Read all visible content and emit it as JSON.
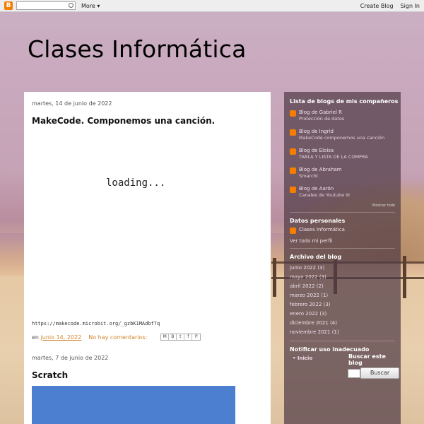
{
  "navbar": {
    "logo_text": "B",
    "more_label": "More ▾",
    "create_blog": "Create Blog",
    "sign_in": "Sign In"
  },
  "blog_title": "Clases Informática",
  "posts": [
    {
      "date": "martes, 14 de junio de 2022",
      "title": "MakeCode. Componemos una canción.",
      "embed_text": "loading...",
      "link": "https://makecode.microbit.org/_gzbK1MAdbf7q",
      "footer_prefix": "en",
      "footer_date": "junio 14, 2022",
      "comments": "No hay comentarios:",
      "share_buttons": [
        "M",
        "B",
        "t",
        "f",
        "P"
      ]
    },
    {
      "date": "martes, 7 de junio de 2022",
      "title": "Scratch"
    }
  ],
  "sidebar": {
    "blogs_heading": "Lista de blogs de mis compañeros",
    "blogs": [
      {
        "name": "Blog de Gabriel R",
        "sub": "Protección de datos"
      },
      {
        "name": "Blog de Ingrid",
        "sub": "MakeCode componemos una canción"
      },
      {
        "name": "Blog de Eloisa",
        "sub": "TABLA Y LISTA DE LA COMPRA"
      },
      {
        "name": "Blog de Abraham",
        "sub": "Smarcht"
      },
      {
        "name": "Blog de Aarón",
        "sub": "Canales de Youtube III"
      }
    ],
    "show_all": "Mostrar todo",
    "profile_heading": "Datos personales",
    "profile_name": "Clases Informática",
    "profile_link": "Ver todo mi perfil",
    "archive_heading": "Archivo del blog",
    "archive": [
      {
        "month": "junio 2022",
        "count": "(3)"
      },
      {
        "month": "mayo 2022",
        "count": "(3)"
      },
      {
        "month": "abril 2022",
        "count": "(2)"
      },
      {
        "month": "marzo 2022",
        "count": "(1)"
      },
      {
        "month": "febrero 2022",
        "count": "(3)"
      },
      {
        "month": "enero 2022",
        "count": "(3)"
      },
      {
        "month": "diciembre 2021",
        "count": "(4)"
      },
      {
        "month": "noviembre 2021",
        "count": "(1)"
      }
    ],
    "report_heading": "Notificar uso inadecuado",
    "pages_item": "Inicio",
    "search_heading": "Buscar este blog",
    "search_button": "Buscar"
  }
}
